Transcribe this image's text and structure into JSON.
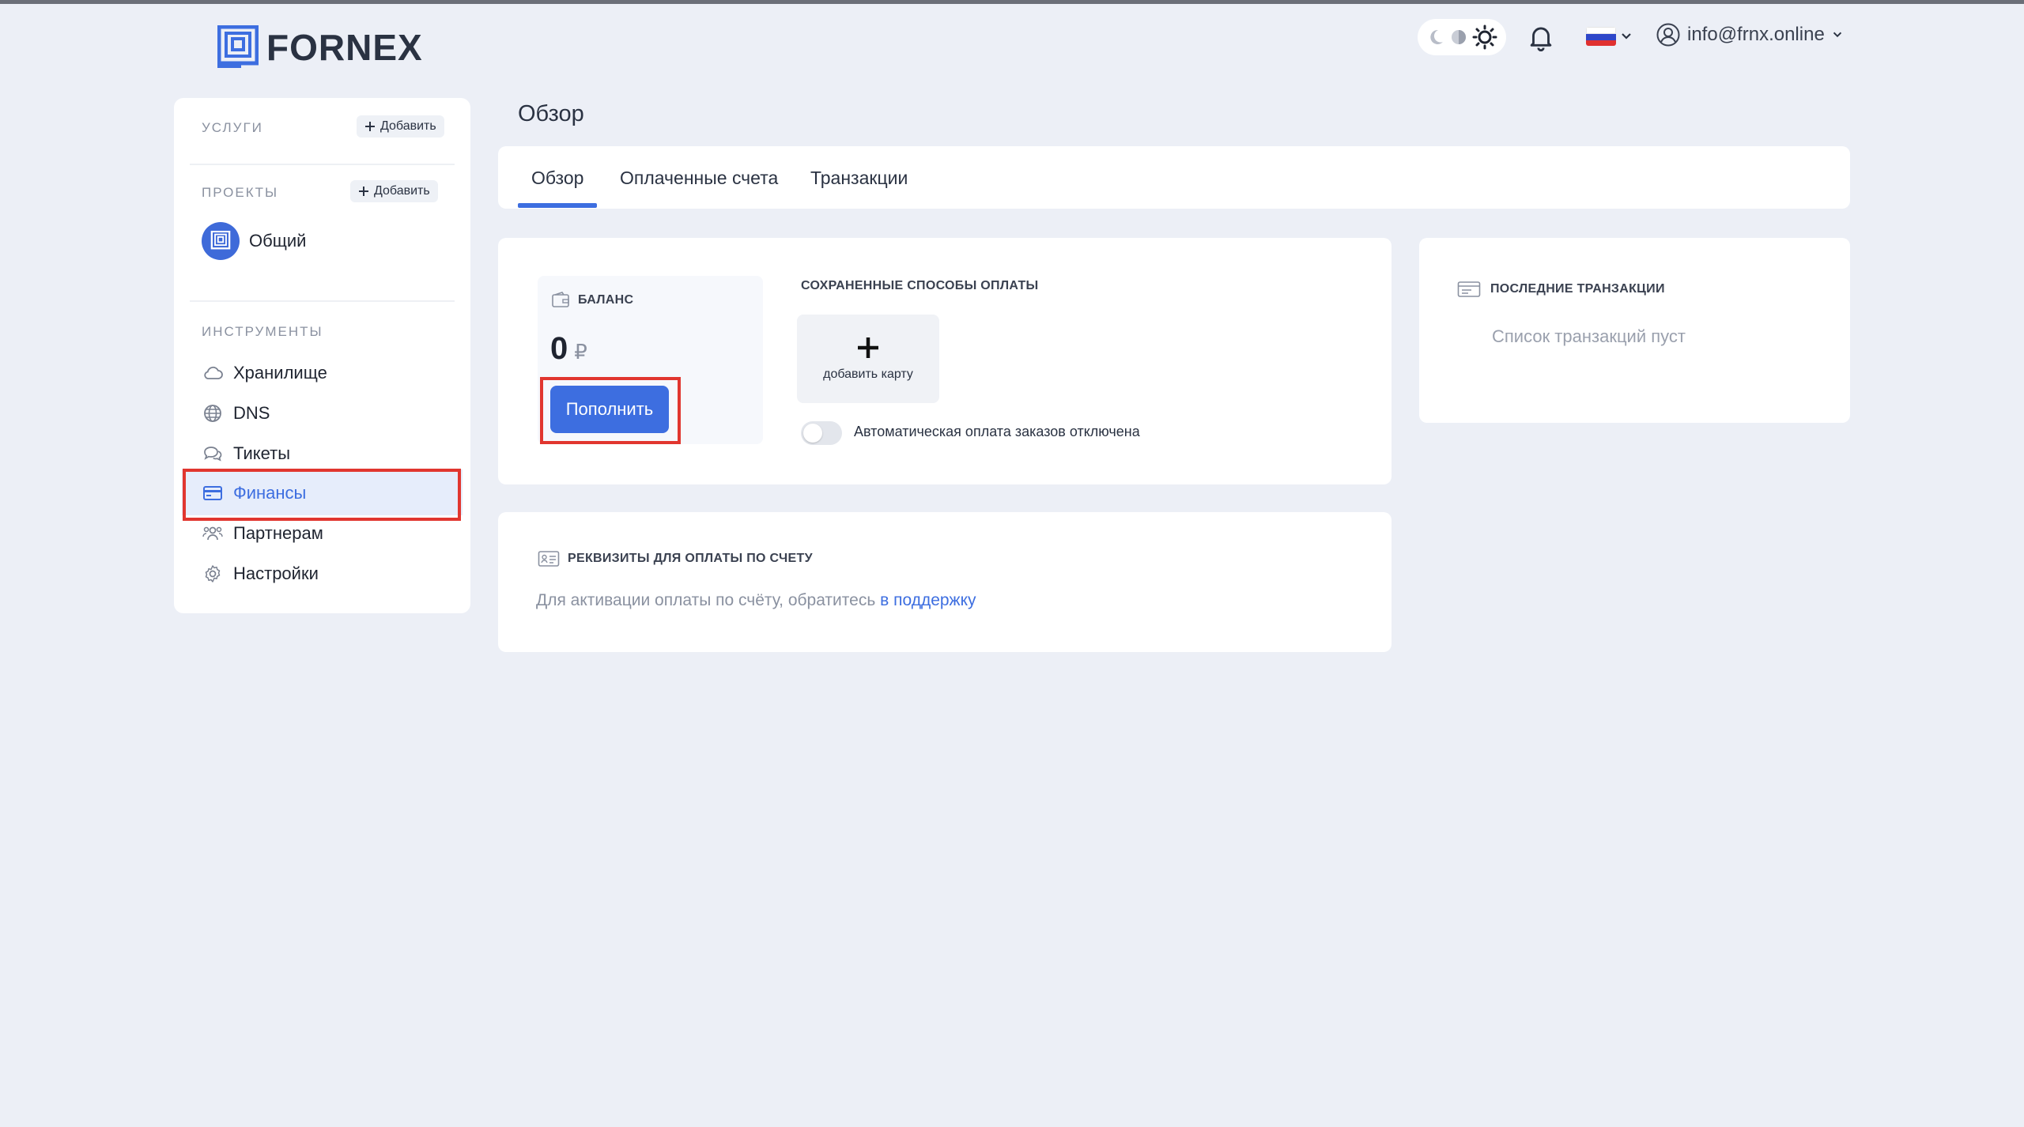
{
  "brand": {
    "name": "FORNEX"
  },
  "header": {
    "theme_icons": [
      "moon-icon",
      "half-moon-icon",
      "sun-icon"
    ],
    "notifications_icon": "bell-icon",
    "language_flag": "ru-flag",
    "user_email": "info@frnx.online"
  },
  "sidebar": {
    "services": {
      "title": "УСЛУГИ",
      "add_label": "Добавить"
    },
    "projects": {
      "title": "ПРОЕКТЫ",
      "add_label": "Добавить",
      "items": [
        {
          "label": "Общий"
        }
      ]
    },
    "tools": {
      "title": "ИНСТРУМЕНТЫ",
      "items": [
        {
          "label": "Хранилище",
          "icon": "cloud-icon"
        },
        {
          "label": "DNS",
          "icon": "globe-icon"
        },
        {
          "label": "Тикеты",
          "icon": "chat-icon"
        },
        {
          "label": "Финансы",
          "icon": "card-icon",
          "active": true
        },
        {
          "label": "Партнерам",
          "icon": "users-icon"
        },
        {
          "label": "Настройки",
          "icon": "gear-icon"
        }
      ]
    }
  },
  "main": {
    "title": "Обзор",
    "tabs": [
      {
        "label": "Обзор",
        "active": true
      },
      {
        "label": "Оплаченные счета"
      },
      {
        "label": "Транзакции"
      }
    ],
    "balance": {
      "title": "БАЛАНС",
      "amount": "0",
      "currency": "₽",
      "topup_label": "Пополнить"
    },
    "payment_methods": {
      "title": "СОХРАНЕННЫЕ СПОСОБЫ ОПЛАТЫ",
      "add_card_label": "добавить карту"
    },
    "autopay": {
      "label": "Автоматическая оплата заказов отключена",
      "enabled": false
    },
    "invoice_details": {
      "title": "РЕКВИЗИТЫ ДЛЯ ОПЛАТЫ ПО СЧЕТУ",
      "text": "Для активации оплаты по счёту, обратитесь ",
      "link": "в поддержку"
    },
    "recent_transactions": {
      "title": "ПОСЛЕДНИЕ ТРАНЗАКЦИИ",
      "empty_text": "Список транзакций пуст"
    }
  },
  "colors": {
    "accent": "#3d6ee0",
    "highlight": "#e1362f",
    "background": "#eceff6"
  }
}
